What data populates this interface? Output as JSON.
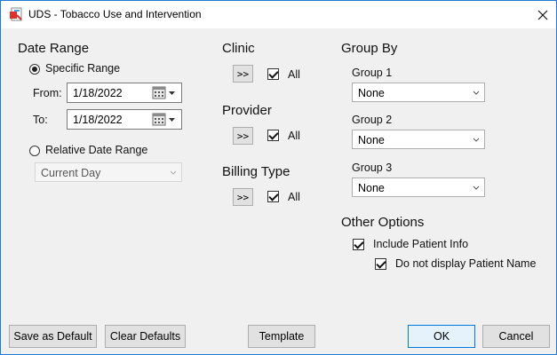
{
  "window": {
    "title": "UDS - Tobacco Use and Intervention"
  },
  "date_range": {
    "title": "Date Range",
    "specific_label": "Specific Range",
    "specific_selected": true,
    "from_label": "From:",
    "from_value": "1/18/2022",
    "to_label": "To:",
    "to_value": "1/18/2022",
    "relative_label": "Relative Date Range",
    "relative_selected": false,
    "relative_value": "Current Day"
  },
  "clinic": {
    "title": "Clinic",
    "button_label": ">>",
    "all_label": "All",
    "all_checked": true
  },
  "provider": {
    "title": "Provider",
    "button_label": ">>",
    "all_label": "All",
    "all_checked": true
  },
  "billing_type": {
    "title": "Billing Type",
    "button_label": ">>",
    "all_label": "All",
    "all_checked": true
  },
  "group_by": {
    "title": "Group By",
    "groups": [
      {
        "label": "Group 1",
        "value": "None"
      },
      {
        "label": "Group 2",
        "value": "None"
      },
      {
        "label": "Group 3",
        "value": "None"
      }
    ]
  },
  "other_options": {
    "title": "Other Options",
    "include_patient_info_label": "Include Patient Info",
    "include_patient_info_checked": true,
    "hide_patient_name_label": "Do not display Patient Name",
    "hide_patient_name_checked": true
  },
  "buttons": {
    "save_default": "Save as Default",
    "clear_defaults": "Clear Defaults",
    "template": "Template",
    "ok": "OK",
    "cancel": "Cancel"
  }
}
